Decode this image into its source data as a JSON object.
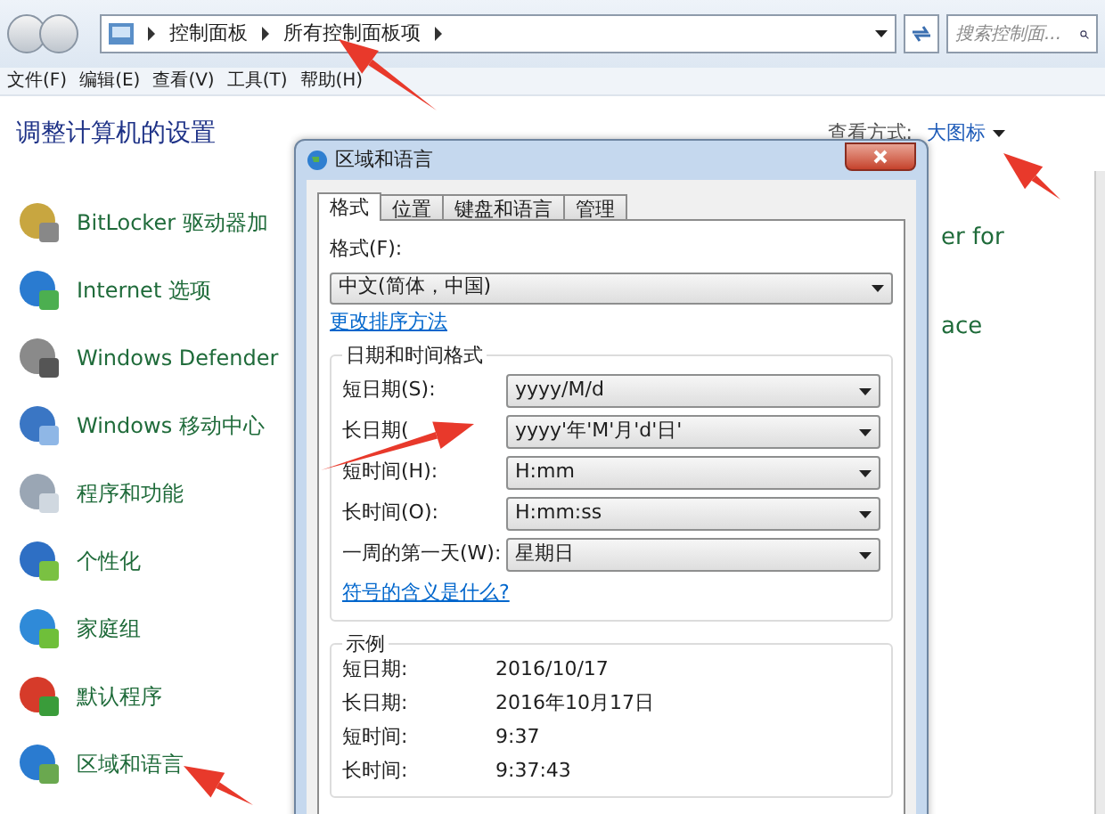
{
  "address_bar": {
    "breadcrumb": [
      "控制面板",
      "所有控制面板项"
    ],
    "search": {
      "placeholder": "搜索控制面..."
    }
  },
  "menu": [
    "文件(F)",
    "编辑(E)",
    "查看(V)",
    "工具(T)",
    "帮助(H)"
  ],
  "header": {
    "title": "调整计算机的设置",
    "view_by_label": "查看方式:",
    "view_by_value": "大图标"
  },
  "items": [
    "BitLocker 驱动器加",
    "Internet 选项",
    "Windows Defender",
    "Windows 移动中心",
    "程序和功能",
    "个性化",
    "家庭组",
    "默认程序",
    "区域和语言"
  ],
  "right_column": [
    "er for",
    "ace"
  ],
  "dialog": {
    "title": "区域和语言",
    "tabs": [
      {
        "label": "格式",
        "selected": true
      },
      {
        "label": "位置",
        "selected": false
      },
      {
        "label": "键盘和语言",
        "selected": false
      },
      {
        "label": "管理",
        "selected": false
      }
    ],
    "format_label": "格式(F):",
    "format_value": "中文(简体，中国)",
    "sort_link": "更改排序方法",
    "formats_group": {
      "title": "日期和时间格式",
      "rows": [
        {
          "label": "短日期(S):",
          "value": "yyyy/M/d"
        },
        {
          "label": "长日期(",
          "value": "yyyy'年'M'月'd'日'"
        },
        {
          "label": "短时间(H):",
          "value": "H:mm"
        },
        {
          "label": "长时间(O):",
          "value": "H:mm:ss"
        },
        {
          "label": "一周的第一天(W):",
          "value": "星期日"
        }
      ],
      "link": "符号的含义是什么?"
    },
    "example_group": {
      "title": "示例",
      "rows": [
        {
          "label": "短日期:",
          "value": "2016/10/17"
        },
        {
          "label": "长日期:",
          "value": "2016年10月17日"
        },
        {
          "label": "短时间:",
          "value": "9:37"
        },
        {
          "label": "长时间:",
          "value": "9:37:43"
        }
      ]
    }
  }
}
